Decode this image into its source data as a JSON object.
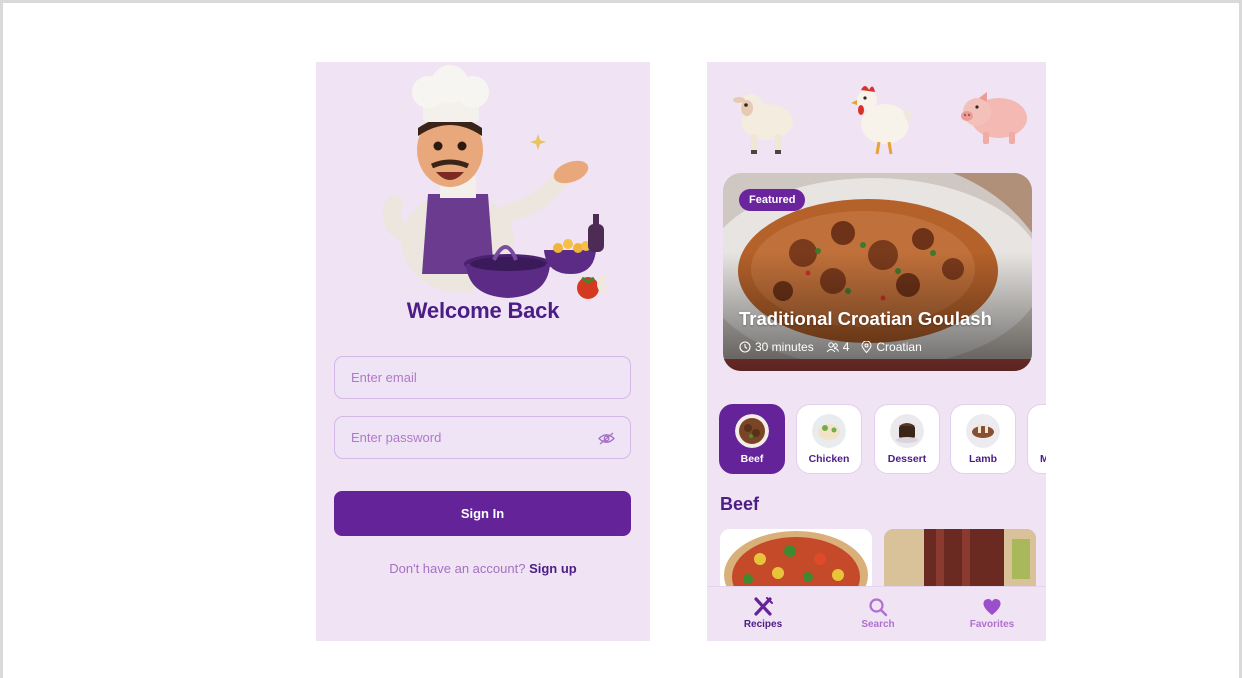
{
  "login": {
    "title": "Welcome Back",
    "email_placeholder": "Enter email",
    "password_placeholder": "Enter password",
    "sign_in_label": "Sign In",
    "signup_prompt": "Don't have an account?",
    "signup_link": "Sign up"
  },
  "recipes": {
    "animals": [
      "lamb",
      "chicken",
      "pig"
    ],
    "featured": {
      "badge": "Featured",
      "title": "Traditional Croatian Goulash",
      "time": "30 minutes",
      "servings": "4",
      "cuisine": "Croatian"
    },
    "categories": [
      {
        "label": "Beef",
        "active": true
      },
      {
        "label": "Chicken",
        "active": false
      },
      {
        "label": "Dessert",
        "active": false
      },
      {
        "label": "Lamb",
        "active": false
      },
      {
        "label": "M",
        "active": false
      }
    ],
    "section_title": "Beef",
    "tabs": [
      {
        "label": "Recipes",
        "icon": "utensils-icon",
        "active": true
      },
      {
        "label": "Search",
        "icon": "search-icon",
        "active": false
      },
      {
        "label": "Favorites",
        "icon": "heart-icon",
        "active": false
      }
    ]
  },
  "colors": {
    "primary": "#65239a",
    "primary_text": "#4c1d86",
    "muted_text": "#a571c2",
    "screen_bg": "#efe3f4"
  }
}
